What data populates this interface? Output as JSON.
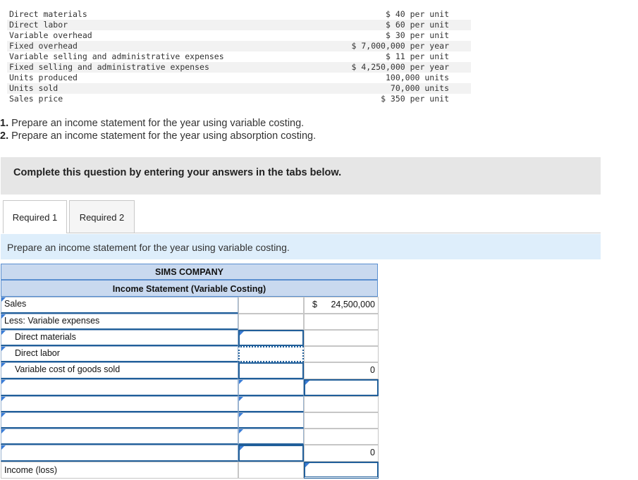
{
  "given": [
    {
      "label": "Direct materials",
      "value": "$ 40 per unit"
    },
    {
      "label": "Direct labor",
      "value": "$ 60 per unit"
    },
    {
      "label": "Variable overhead",
      "value": "$ 30 per unit"
    },
    {
      "label": "Fixed overhead",
      "value": "$ 7,000,000 per year"
    },
    {
      "label": "Variable selling and administrative expenses",
      "value": "$ 11 per unit"
    },
    {
      "label": "Fixed selling and administrative expenses",
      "value": "$ 4,250,000 per year"
    },
    {
      "label": "Units produced",
      "value": "100,000 units"
    },
    {
      "label": "Units sold",
      "value": "70,000 units"
    },
    {
      "label": "Sales price",
      "value": "$ 350 per unit"
    }
  ],
  "questions": [
    {
      "num": "1.",
      "text": " Prepare an income statement for the year using variable costing."
    },
    {
      "num": "2.",
      "text": " Prepare an income statement for the year using absorption costing."
    }
  ],
  "banner": "Complete this question by entering your answers in the tabs below.",
  "tabs": [
    {
      "label": "Required 1"
    },
    {
      "label": "Required 2"
    }
  ],
  "instruction": "Prepare an income statement for the year using variable costing.",
  "statement": {
    "company": "SIMS COMPANY",
    "title": "Income Statement (Variable Costing)",
    "rows": [
      {
        "label": "Sales",
        "dollar": "$",
        "value": "24,500,000"
      },
      {
        "label": "Less: Variable expenses"
      },
      {
        "label": "Direct materials"
      },
      {
        "label": "Direct labor"
      },
      {
        "label": "Variable cost of goods sold",
        "value": "0"
      },
      {
        "label": ""
      },
      {
        "label": ""
      },
      {
        "label": ""
      },
      {
        "label": ""
      },
      {
        "label": "",
        "value": "0"
      },
      {
        "label": "Income (loss)"
      }
    ]
  }
}
